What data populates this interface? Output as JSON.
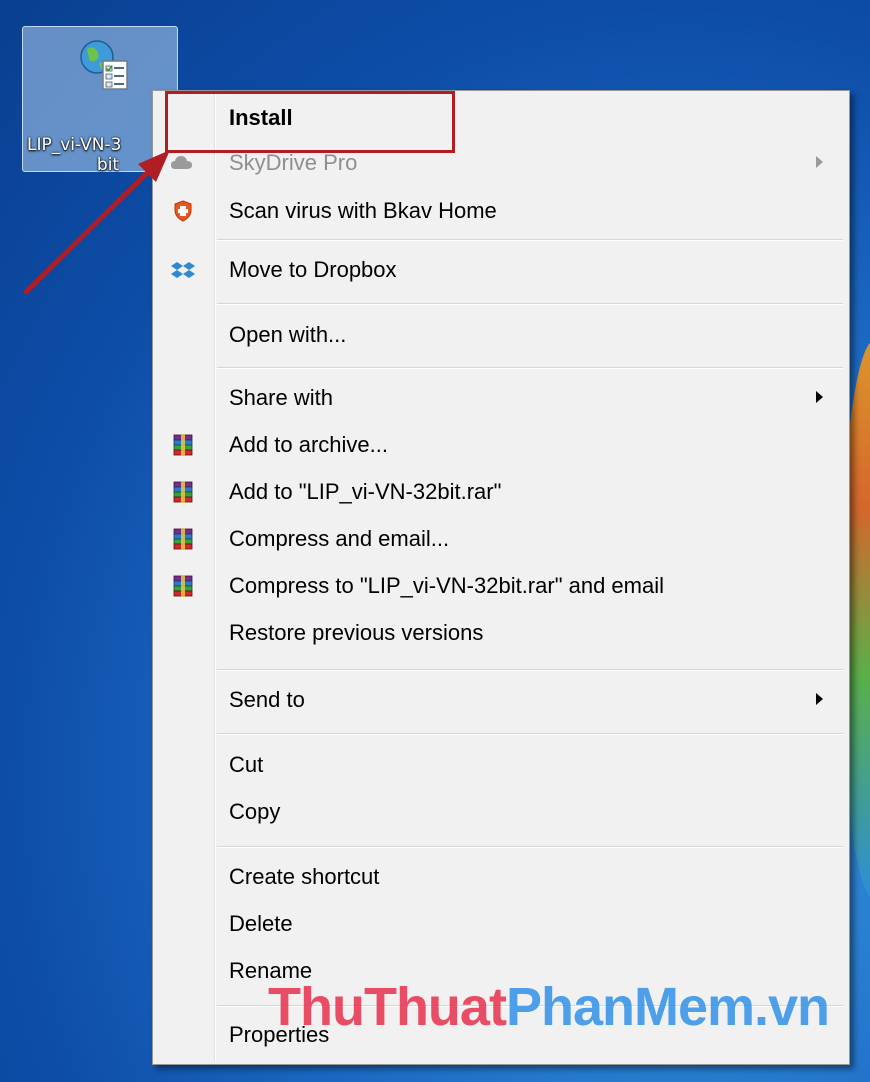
{
  "desktop": {
    "icon": {
      "name_line1": "LIP_vi-VN-3",
      "name_line2": "bit",
      "icon_name": "language-pack-icon"
    }
  },
  "context_menu": {
    "items": [
      {
        "label": "Install",
        "bold": true
      },
      {
        "label": "SkyDrive Pro",
        "disabled": true,
        "submenu": true,
        "icon": "skydrive-icon"
      },
      {
        "label": "Scan virus with Bkav Home",
        "icon": "bkav-shield-icon"
      },
      {
        "label": "Move to Dropbox",
        "icon": "dropbox-icon"
      },
      {
        "label": "Open with..."
      },
      {
        "label": "Share with",
        "submenu": true
      },
      {
        "label": "Add to archive...",
        "icon": "winrar-icon"
      },
      {
        "label": "Add to \"LIP_vi-VN-32bit.rar\"",
        "icon": "winrar-icon"
      },
      {
        "label": "Compress and email...",
        "icon": "winrar-icon"
      },
      {
        "label": "Compress to \"LIP_vi-VN-32bit.rar\" and email",
        "icon": "winrar-icon"
      },
      {
        "label": "Restore previous versions"
      },
      {
        "label": "Send to",
        "submenu": true
      },
      {
        "label": "Cut"
      },
      {
        "label": "Copy"
      },
      {
        "label": "Create shortcut"
      },
      {
        "label": "Delete"
      },
      {
        "label": "Rename"
      },
      {
        "label": "Properties"
      }
    ]
  },
  "watermark": {
    "part_a": "ThuThuat",
    "part_b": "PhanMem.vn"
  },
  "colors": {
    "highlight_box": "#b01e23",
    "arrow": "#b01e23",
    "menu_background": "#f1f1f1",
    "desktop_background": "#1f6fc8"
  }
}
